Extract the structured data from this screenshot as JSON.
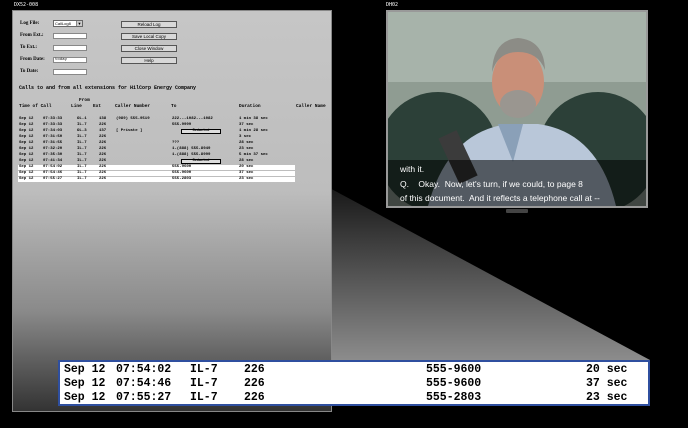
{
  "doc_panel": {
    "label": "DX52-008",
    "form": {
      "log_file_label": "Log File:",
      "log_file_value": "CallLog8",
      "from_ext_label": "From Ext.:",
      "to_ext_label": "To Ext.:",
      "from_date_label": "From Date:",
      "from_date_value": "today",
      "to_date_label": "To Date:"
    },
    "buttons": [
      "Reload Log",
      "Save Local Copy",
      "Close Window",
      "Help"
    ],
    "heading": "Calls to and from all extensions for HilCorp Energy Company",
    "columns": {
      "time_of_call": "Time of Call",
      "from_line_top": "From",
      "from_line": "Line",
      "ext": "Ext",
      "caller_number": "Caller Number",
      "to": "To",
      "duration": "Duration",
      "caller_name": "Caller Name"
    },
    "rows": [
      {
        "date": "Sep 12",
        "time": "07:33:33",
        "line": "OL-1",
        "ext": "138",
        "caller": "(989) 555-9519",
        "to": "222---1082---1082",
        "duration": "1 min 38 sec",
        "highlight": false
      },
      {
        "date": "Sep 12",
        "time": "07:33:33",
        "line": "IL-7",
        "ext": "226",
        "caller": "",
        "to": "555-9999",
        "duration": "37 sec",
        "highlight": false
      },
      {
        "date": "Sep 12",
        "time": "07:34:03",
        "line": "OL-3",
        "ext": "137",
        "caller": "[ Private ]",
        "to": "",
        "redacted": true,
        "duration": "1 min 28 sec",
        "highlight": false
      },
      {
        "date": "Sep 12",
        "time": "07:31:50",
        "line": "IL-7",
        "ext": "226",
        "caller": "",
        "to": "",
        "duration": "3 sec",
        "highlight": false
      },
      {
        "date": "Sep 12",
        "time": "07:31:55",
        "line": "IL-7",
        "ext": "226",
        "caller": "",
        "to": "???",
        "duration": "28 sec",
        "highlight": false
      },
      {
        "date": "Sep 12",
        "time": "07:32:20",
        "line": "IL-7",
        "ext": "226",
        "caller": "",
        "to": "1-(888) 555-8949",
        "duration": "23 sec",
        "highlight": false
      },
      {
        "date": "Sep 12",
        "time": "07:35:30",
        "line": "IL-7",
        "ext": "226",
        "caller": "",
        "to": "1-(888) 555-8999",
        "duration": "5 min 37 sec",
        "highlight": false
      },
      {
        "date": "Sep 12",
        "time": "07:41:34",
        "line": "IL-7",
        "ext": "226",
        "caller": "",
        "to": "",
        "redacted": true,
        "duration": "28 sec",
        "highlight": false
      },
      {
        "date": "Sep 12",
        "time": "07:54:02",
        "line": "IL-7",
        "ext": "226",
        "caller": "",
        "to": "555-9600",
        "duration": "20 sec",
        "highlight": true
      },
      {
        "date": "Sep 12",
        "time": "07:54:46",
        "line": "IL-7",
        "ext": "226",
        "caller": "",
        "to": "555-9600",
        "duration": "37 sec",
        "highlight": true
      },
      {
        "date": "Sep 12",
        "time": "07:55:27",
        "line": "IL-7",
        "ext": "226",
        "caller": "",
        "to": "555-2803",
        "duration": "23 sec",
        "highlight": true
      }
    ],
    "redacted_label": "Redacted"
  },
  "video_panel": {
    "label": "DH02",
    "caption_lines": [
      "with it.",
      "Q.    Okay.  Now, let's turn, if we could, to page 8",
      "of this document.  And it reflects a telephone call at --"
    ]
  },
  "zoom_rows": [
    {
      "date": "Sep 12",
      "time": "07:54:02",
      "line": "IL-7",
      "ext": "226",
      "to": "555-9600",
      "duration": "20 sec"
    },
    {
      "date": "Sep 12",
      "time": "07:54:46",
      "line": "IL-7",
      "ext": "226",
      "to": "555-9600",
      "duration": "37 sec"
    },
    {
      "date": "Sep 12",
      "time": "07:55:27",
      "line": "IL-7",
      "ext": "226",
      "to": "555-2803",
      "duration": "23 sec"
    }
  ],
  "colors": {
    "zoom_border": "#2f4f9f",
    "background": "#000000"
  }
}
